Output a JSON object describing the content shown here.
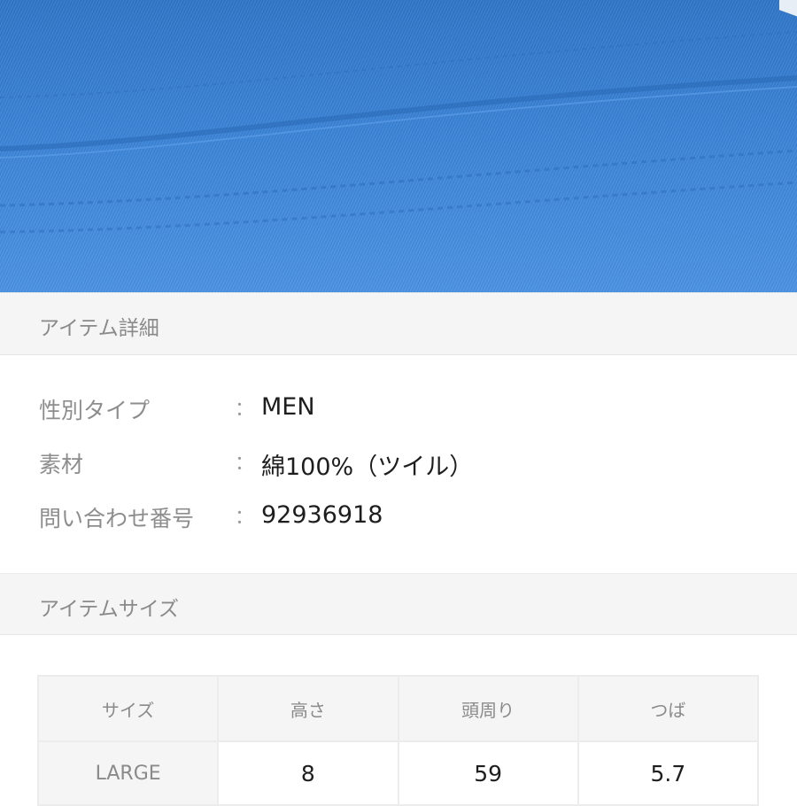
{
  "hero": {
    "fabric_color": "#3a84d8",
    "alt": "blue twill bucket hat closeup"
  },
  "item_detail": {
    "heading": "アイテム詳細",
    "rows": [
      {
        "label": "性別タイプ",
        "colon": "：",
        "value": "MEN"
      },
      {
        "label": "素材",
        "colon": "：",
        "value": "綿100%（ツイル）"
      },
      {
        "label": "問い合わせ番号",
        "colon": "：",
        "value": "92936918"
      }
    ]
  },
  "item_size": {
    "heading": "アイテムサイズ",
    "columns": [
      "サイズ",
      "高さ",
      "頭周り",
      "つば"
    ],
    "rows": [
      {
        "size": "LARGE",
        "height": "8",
        "head": "59",
        "brim": "5.7"
      }
    ]
  }
}
